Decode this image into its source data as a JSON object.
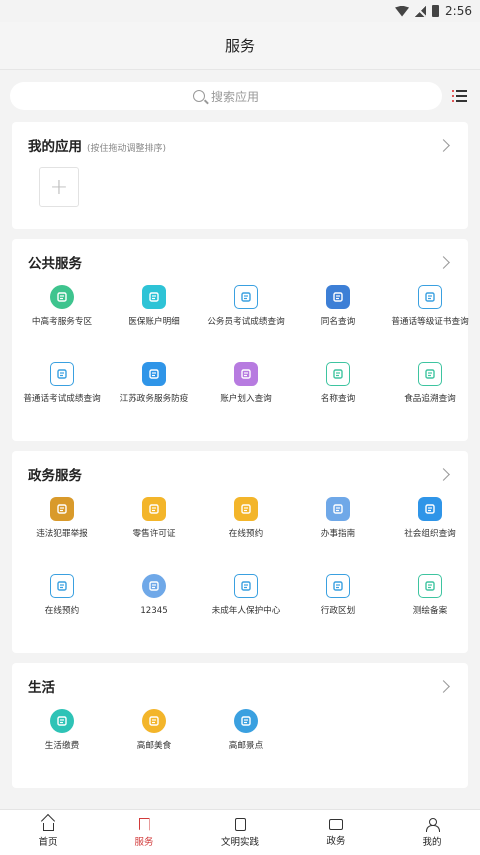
{
  "status_bar": {
    "time": "2:56"
  },
  "header": {
    "title": "服务"
  },
  "search": {
    "placeholder": "搜索应用"
  },
  "my_apps": {
    "title": "我的应用",
    "hint": "(按住拖动调整排序)",
    "add_symbol": "+"
  },
  "public_services": {
    "title": "公共服务",
    "items": [
      {
        "label": "中高考服务专区",
        "icon": "exam-icon",
        "color": "#3ec48e"
      },
      {
        "label": "医保账户明细",
        "icon": "medical-account-icon",
        "color": "#2ec3d6"
      },
      {
        "label": "公务员考试成绩查询",
        "icon": "score-clipboard-icon",
        "color": "#3aa0e0"
      },
      {
        "label": "同名查询",
        "icon": "name-search-icon",
        "color": "#3d7fd6"
      },
      {
        "label": "普通话等级证书查询",
        "icon": "certificate-icon",
        "color": "#3aa0e0"
      },
      {
        "label": "普通话考试成绩查询",
        "icon": "exam-score-icon",
        "color": "#3aa0e0"
      },
      {
        "label": "江苏政务服务防疫",
        "icon": "speaker-icon",
        "color": "#2f95e8"
      },
      {
        "label": "账户划入查询",
        "icon": "account-transfer-icon",
        "color": "#b77be0"
      },
      {
        "label": "名称查询",
        "icon": "name-query-icon",
        "color": "#3ec4a0"
      },
      {
        "label": "食品追溯查询",
        "icon": "food-trace-icon",
        "color": "#3ec4a0"
      }
    ]
  },
  "gov_services": {
    "title": "政务服务",
    "items": [
      {
        "label": "违法犯罪举报",
        "icon": "report-icon",
        "color": "#d99a2b"
      },
      {
        "label": "零售许可证",
        "icon": "retail-license-icon",
        "color": "#f3b52a"
      },
      {
        "label": "在线预约",
        "icon": "appointment-icon",
        "color": "#f3b52a"
      },
      {
        "label": "办事指南",
        "icon": "guide-icon",
        "color": "#6fa8e8"
      },
      {
        "label": "社会组织查询",
        "icon": "monitor-search-icon",
        "color": "#2f95e8"
      },
      {
        "label": "在线预约",
        "icon": "online-booking-icon",
        "color": "#3aa0e0"
      },
      {
        "label": "12345",
        "icon": "hotline-icon",
        "color": "#6fa8e8"
      },
      {
        "label": "未成年人保护中心",
        "icon": "umbrella-icon",
        "color": "#3aa0e0"
      },
      {
        "label": "行政区划",
        "icon": "map-division-icon",
        "color": "#3aa0e0"
      },
      {
        "label": "测绘备案",
        "icon": "survey-record-icon",
        "color": "#3ec4a0"
      }
    ]
  },
  "life": {
    "title": "生活",
    "items": [
      {
        "label": "生活缴费",
        "icon": "payment-icon",
        "color": "#2ec3b6"
      },
      {
        "label": "高邮美食",
        "icon": "food-icon",
        "color": "#f3b52a"
      },
      {
        "label": "高邮景点",
        "icon": "scenic-bus-icon",
        "color": "#3aa0e0"
      }
    ]
  },
  "bottom_nav": [
    {
      "label": "首页",
      "icon": "home-icon"
    },
    {
      "label": "服务",
      "icon": "bookmark-icon",
      "active": true
    },
    {
      "label": "文明实践",
      "icon": "clipboard-icon"
    },
    {
      "label": "政务",
      "icon": "chat-icon"
    },
    {
      "label": "我的",
      "icon": "user-icon"
    }
  ]
}
